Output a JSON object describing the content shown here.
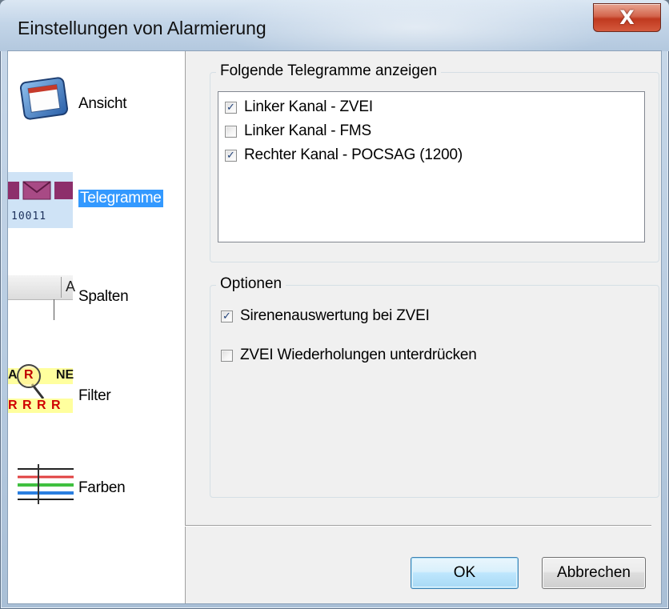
{
  "window": {
    "title": "Einstellungen von Alarmierung",
    "close_glyph": "X"
  },
  "sidebar": {
    "items": [
      {
        "label": "Ansicht",
        "icon": "window-icon",
        "selected": false
      },
      {
        "label": "Telegramme",
        "icon": "telegram-icon",
        "selected": true,
        "icon_text": "10011"
      },
      {
        "label": "Spalten",
        "icon": "columns-icon",
        "selected": false,
        "icon_text": "A"
      },
      {
        "label": "Filter",
        "icon": "filter-magnifier-icon",
        "selected": false,
        "icon_text_top": "A",
        "icon_text_circle": "R",
        "icon_text_right": "NE",
        "icon_text_bottom": "R R R R"
      },
      {
        "label": "Farben",
        "icon": "color-lines-icon",
        "selected": false
      }
    ]
  },
  "telegrams_group": {
    "title": "Folgende Telegramme anzeigen",
    "items": [
      {
        "label": "Linker Kanal - ZVEI",
        "checked": true
      },
      {
        "label": "Linker Kanal - FMS",
        "checked": false
      },
      {
        "label": "Rechter Kanal - POCSAG (1200)",
        "checked": true
      }
    ]
  },
  "options_group": {
    "title": "Optionen",
    "items": [
      {
        "label": "Sirenenauswertung bei ZVEI",
        "checked": true
      },
      {
        "label": "ZVEI Wiederholungen unterdrücken",
        "checked": false
      }
    ]
  },
  "buttons": {
    "ok": "OK",
    "cancel": "Abbrechen"
  },
  "colors": {
    "selection": "#3399ff",
    "close_button": "#c0391f",
    "check_mark": "#21427a"
  },
  "check_glyph": "✓"
}
